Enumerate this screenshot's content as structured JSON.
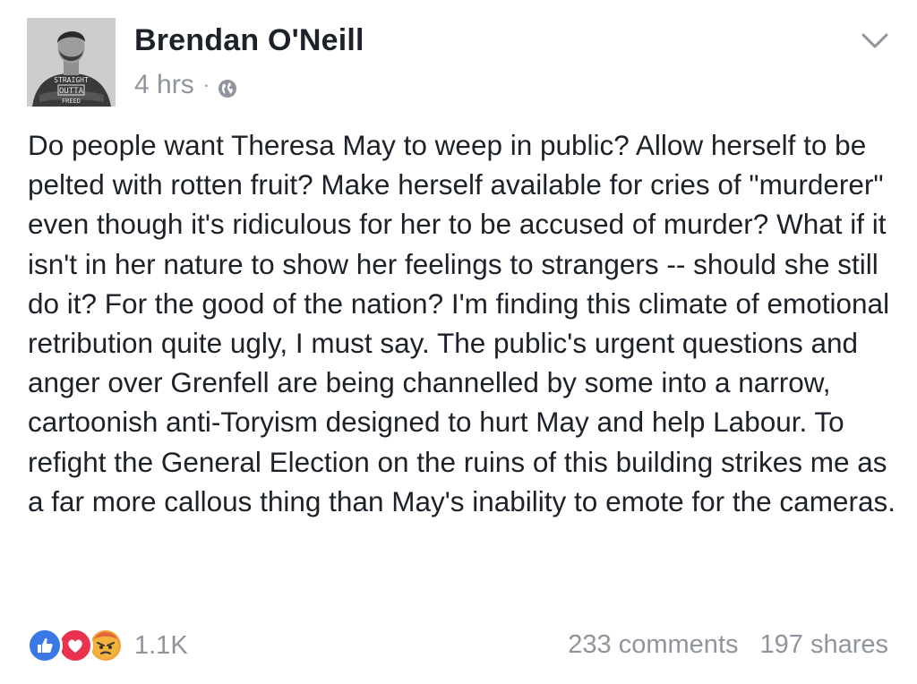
{
  "post": {
    "author": "Brendan O'Neill",
    "time": "4 hrs",
    "separator": "·",
    "privacy_icon": "globe-icon",
    "menu_icon": "chevron-down-icon",
    "avatar": {
      "shirt_text_1": "STRAIGHT",
      "shirt_text_2": "OUTTA",
      "shirt_text_3": "FREED"
    },
    "body": "Do people want Theresa May to weep in public? Allow herself to be pelted with rotten fruit? Make herself available for cries of \"murderer\" even though it's ridiculous for her to be accused of murder? What if it isn't in her nature to show her feelings to strangers -- should she still do it? For the good of the nation? I'm finding this climate of emotional retribution quite ugly, I must say. The public's urgent questions and anger over Grenfell are being channelled by some into a narrow, cartoonish anti-Toryism designed to hurt May and help Labour. To refight the General Election on the ruins of this building strikes me as a far more callous thing than May's inability to emote for the cameras."
  },
  "footer": {
    "reactions": [
      "like-icon",
      "love-icon",
      "angry-icon"
    ],
    "reaction_count": "1.1K",
    "comments": "233 comments",
    "shares": "197 shares"
  },
  "colors": {
    "text": "#1d2129",
    "muted": "#90949c",
    "like": "#3b78e7",
    "love": "#e9324e",
    "angry": "#f0a33a"
  }
}
